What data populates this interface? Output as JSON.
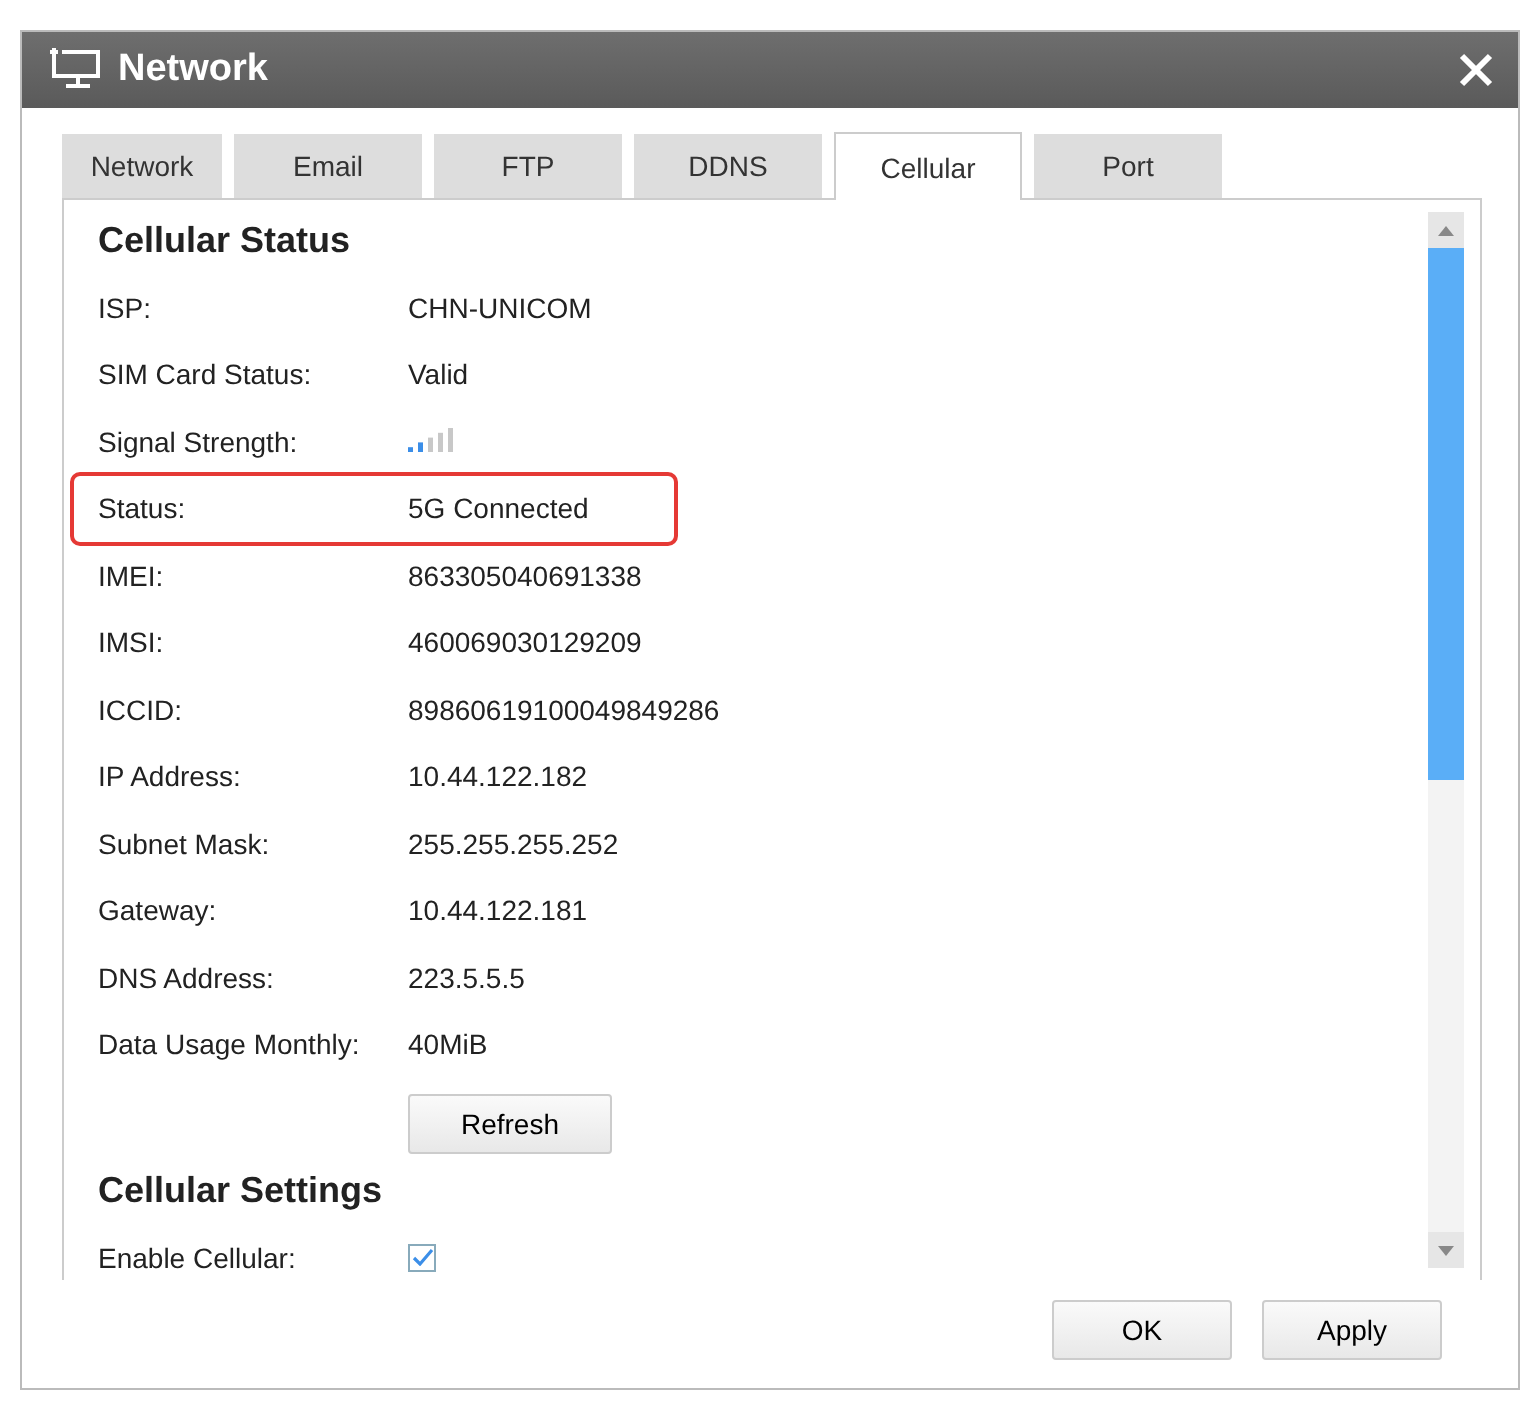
{
  "window": {
    "title": "Network"
  },
  "tabs": [
    {
      "label": "Network",
      "selected": false
    },
    {
      "label": "Email",
      "selected": false
    },
    {
      "label": "FTP",
      "selected": false
    },
    {
      "label": "DDNS",
      "selected": false
    },
    {
      "label": "Cellular",
      "selected": true
    },
    {
      "label": "Port",
      "selected": false
    }
  ],
  "cellular_status": {
    "heading": "Cellular Status",
    "rows": [
      {
        "kind": "text",
        "label": "ISP:",
        "value": "CHN-UNICOM",
        "highlighted": false
      },
      {
        "kind": "text",
        "label": "SIM Card Status:",
        "value": "Valid",
        "highlighted": false
      },
      {
        "kind": "signal",
        "label": "Signal Strength:",
        "highlighted": false
      },
      {
        "kind": "text",
        "label": "Status:",
        "value": "5G Connected",
        "highlighted": true
      },
      {
        "kind": "text",
        "label": "IMEI:",
        "value": "863305040691338",
        "highlighted": false
      },
      {
        "kind": "text",
        "label": "IMSI:",
        "value": "460069030129209",
        "highlighted": false
      },
      {
        "kind": "text",
        "label": "ICCID:",
        "value": "89860619100049849286",
        "highlighted": false
      },
      {
        "kind": "text",
        "label": "IP Address:",
        "value": "10.44.122.182",
        "highlighted": false
      },
      {
        "kind": "text",
        "label": "Subnet Mask:",
        "value": "255.255.255.252",
        "highlighted": false
      },
      {
        "kind": "text",
        "label": "Gateway:",
        "value": "10.44.122.181",
        "highlighted": false
      },
      {
        "kind": "text",
        "label": "DNS Address:",
        "value": "223.5.5.5",
        "highlighted": false
      },
      {
        "kind": "text",
        "label": "Data Usage Monthly:",
        "value": "40MiB",
        "highlighted": false
      }
    ],
    "refresh_button": "Refresh"
  },
  "cellular_settings": {
    "heading": "Cellular Settings",
    "rows": [
      {
        "kind": "checkbox",
        "label": "Enable Cellular:",
        "checked": true
      }
    ]
  },
  "buttons": [
    "OK",
    "Apply"
  ]
}
